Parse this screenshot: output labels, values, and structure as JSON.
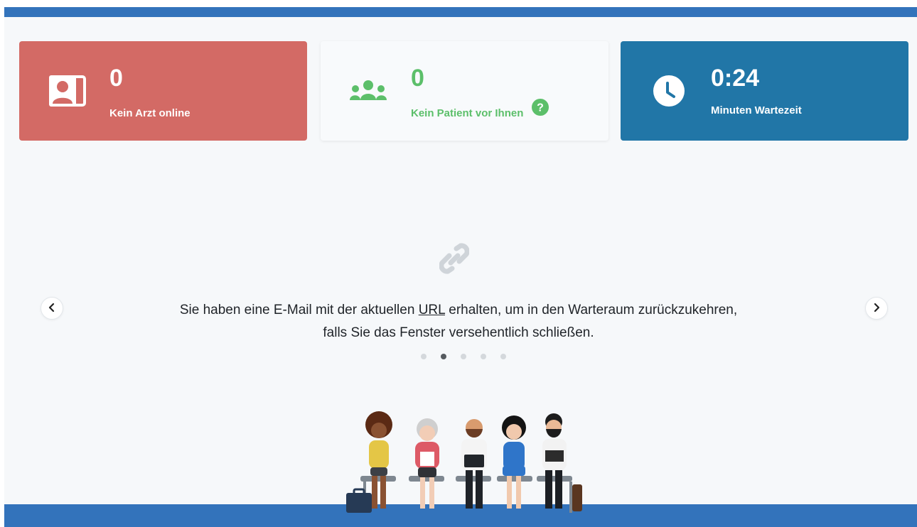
{
  "stats": {
    "doctors": {
      "value": "0",
      "label": "Kein Arzt online",
      "icon": "doctor-screen-icon",
      "color": "#d36a65"
    },
    "patients": {
      "value": "0",
      "label": "Kein Patient vor Ihnen",
      "icon": "users-icon",
      "help_icon": "question-circle-icon",
      "color": "#5cbf6a"
    },
    "wait": {
      "value": "0:24",
      "label": "Minuten Wartezeit",
      "icon": "clock-icon",
      "color": "#2176a7"
    }
  },
  "carousel": {
    "icon": "link-icon",
    "message_before": "Sie haben eine E-Mail mit der aktuellen ",
    "message_link": "URL",
    "message_after": " erhalten, um in den Warteraum zurückzukehren, falls Sie das Fenster versehentlich schließen.",
    "dot_count": 5,
    "active_index": 1
  },
  "colors": {
    "brand_bar": "#3373bb"
  },
  "illustration": "waiting-people-illustration"
}
